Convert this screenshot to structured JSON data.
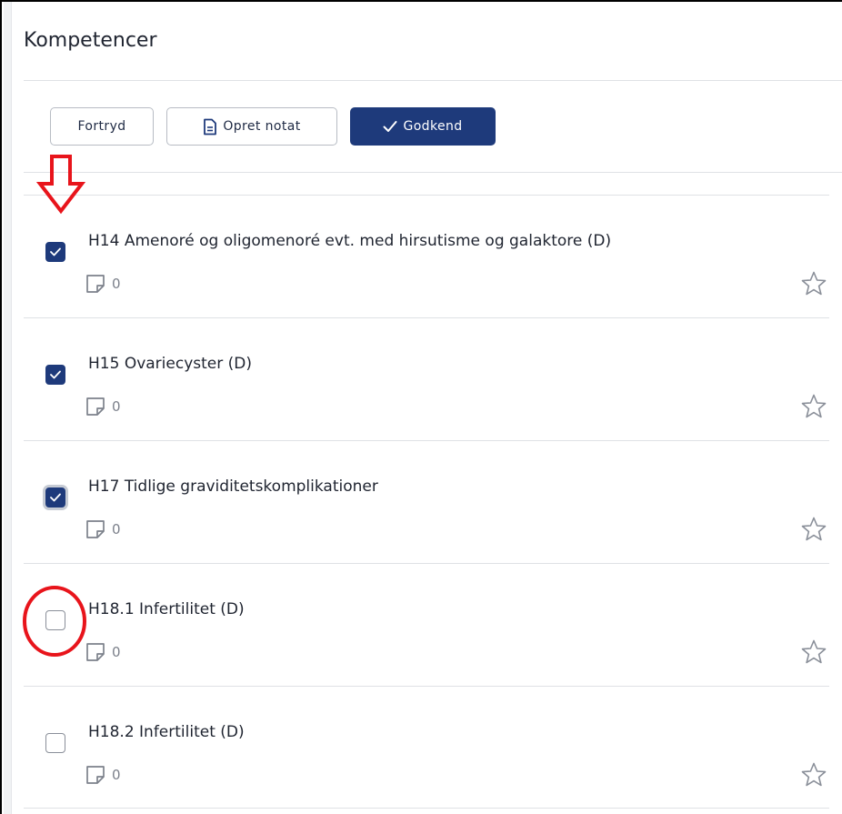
{
  "header": {
    "title": "Kompetencer"
  },
  "toolbar": {
    "cancel_label": "Fortryd",
    "note_label": "Opret notat",
    "approve_label": "Godkend"
  },
  "colors": {
    "primary": "#1e3a7b",
    "annotation": "#e8141b"
  },
  "items": [
    {
      "label": "H14 Amenoré og oligomenoré evt. med hirsutisme og galaktore (D)",
      "checked": true,
      "notes": "0"
    },
    {
      "label": "H15 Ovariecyster (D)",
      "checked": true,
      "notes": "0"
    },
    {
      "label": "H17 Tidlige graviditetskomplikationer",
      "checked": true,
      "notes": "0",
      "focused": true
    },
    {
      "label": "H18.1 Infertilitet (D)",
      "checked": false,
      "notes": "0"
    },
    {
      "label": "H18.2 Infertilitet (D)",
      "checked": false,
      "notes": "0"
    }
  ],
  "icons": {
    "note": "note-icon",
    "star": "star-icon",
    "check": "check-icon",
    "document": "document-icon"
  }
}
